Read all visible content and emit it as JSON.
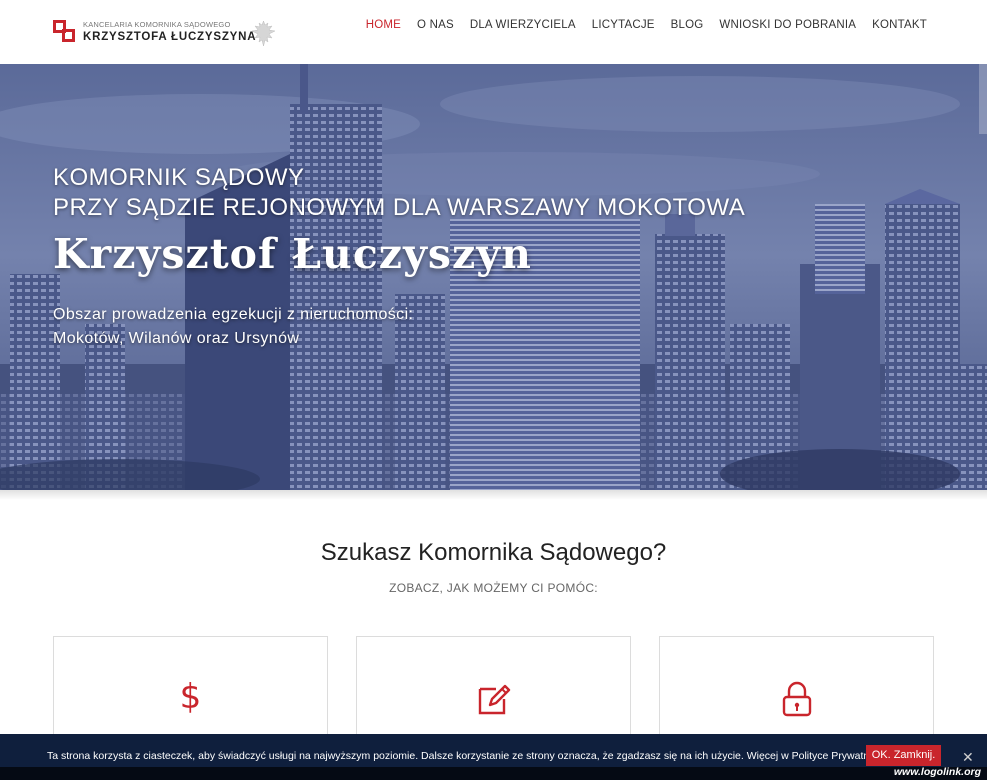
{
  "header": {
    "logo_small": "KANCELARIA KOMORNIKA SĄDOWEGO",
    "logo_big": "KRZYSZTOFA ŁUCZYSZYNA",
    "brand_color": "#c9252c"
  },
  "nav": {
    "items": [
      "HOME",
      "O NAS",
      "DLA WIERZYCIELA",
      "LICYTACJE",
      "BLOG",
      "WNIOSKI DO POBRANIA",
      "KONTAKT"
    ],
    "active": "HOME"
  },
  "hero": {
    "line1": "KOMORNIK SĄDOWY",
    "line2": "PRZY SĄDZIE REJONOWYM DLA WARSZAWY MOKOTOWA",
    "name": "Krzysztof Łuczyszyn",
    "area_line1": "Obszar prowadzenia egzekucji z nieruchomości:",
    "area_line2": "Mokotów, Wilanów oraz Ursynów"
  },
  "section": {
    "title": "Szukasz Komornika Sądowego?",
    "subtitle": "ZOBACZ, JAK MOŻEMY CI POMÓC:"
  },
  "cards": [
    {
      "icon": "dollar-icon",
      "glyph": "$"
    },
    {
      "icon": "edit-icon"
    },
    {
      "icon": "lock-icon"
    }
  ],
  "cookie": {
    "text": "Ta strona korzysta z ciasteczek, aby świadczyć usługi na najwyższym poziomie. Dalsze korzystanie ze strony oznacza, że zgadzasz się na ich użycie. Więcej w Polityce Prywatności",
    "ok_label": "OK. Zamknij.",
    "close_glyph": "✕"
  },
  "watermark": "www.logolink.org"
}
